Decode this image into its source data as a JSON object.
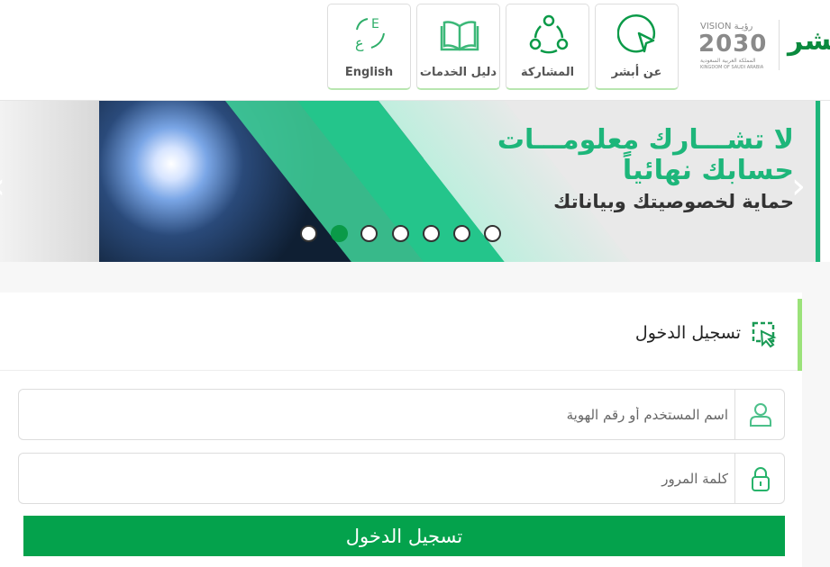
{
  "header": {
    "nav": [
      {
        "label": "عن أبشر",
        "icon": "cursor-circle-icon"
      },
      {
        "label": "المشاركة",
        "icon": "share-network-icon"
      },
      {
        "label": "دليل الخدمات",
        "icon": "open-book-icon"
      },
      {
        "label": "English",
        "icon": "language-switch-icon"
      }
    ],
    "logo": {
      "vision": "VISION رؤيـة",
      "year": "2030",
      "kingdom_ar": "المملكة العربية السعودية",
      "kingdom_en": "KINGDOM OF SAUDI ARABIA",
      "brand": "أبشر"
    }
  },
  "banner": {
    "line1": "لا تشـــارك معلومـــات",
    "line2": "حسابك نهائياً",
    "line3": "حماية لخصوصيتك وبياناتك",
    "slides": 7,
    "active_slide": 2,
    "colors": {
      "green": "#1db67a",
      "dark": "#333333"
    }
  },
  "login": {
    "title": "تسجيل الدخول",
    "username_placeholder": "اسم المستخدم أو رقم الهوية",
    "password_placeholder": "كلمة المرور",
    "submit": "تسجيل الدخول"
  },
  "colors": {
    "accent": "#04a24c",
    "icon": "#27b36b"
  }
}
